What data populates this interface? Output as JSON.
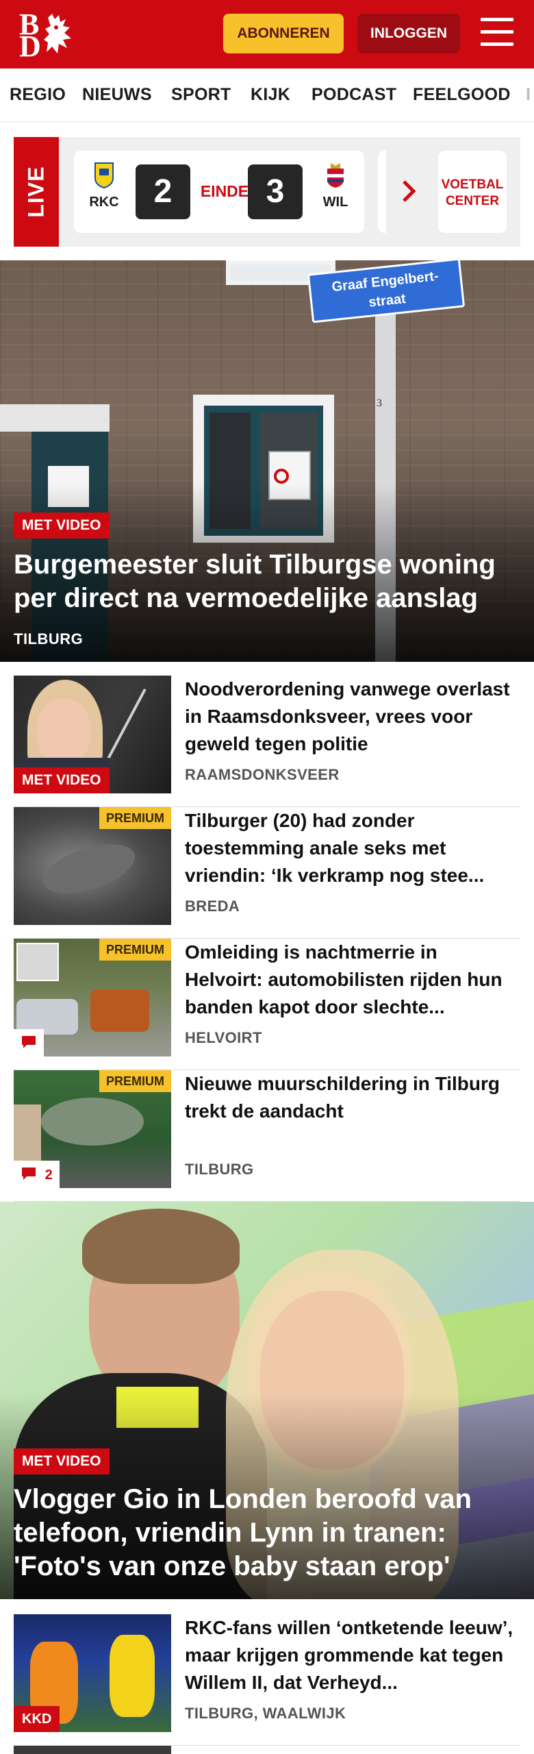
{
  "header": {
    "logo_top": "B",
    "logo_bottom": "D",
    "subscribe_label": "ABONNEREN",
    "login_label": "INLOGGEN",
    "brand_color": "#cd0a12"
  },
  "nav": {
    "items": [
      "REGIO",
      "NIEUWS",
      "SPORT",
      "KIJK",
      "PODCAST",
      "FEELGOOD"
    ]
  },
  "live": {
    "label": "LIVE",
    "match": {
      "home": "RKC",
      "home_score": "2",
      "status": "EINDE",
      "away_score": "3",
      "away": "WIL"
    },
    "center_label_line1": "VOETBAL",
    "center_label_line2": "CENTER"
  },
  "hero": {
    "badge": "MET VIDEO",
    "sign_line1": "Graaf Engelbert-",
    "sign_line2": "straat",
    "title": "Burgemeester sluit Tilburgse woning per direct na vermoedelijke aanslag",
    "location": "TILBURG"
  },
  "articles": [
    {
      "title": "Noodverordening vanwege overlast in Raamsdonksveer, vrees voor geweld tegen politie",
      "location": "RAAMSDONKSVEER",
      "badge": "MET VIDEO"
    },
    {
      "title": "Tilburger (20) had zonder toestemming anale seks met vriendin: ‘Ik verkramp nog stee...",
      "location": "BREDA",
      "premium": "PREMIUM"
    },
    {
      "title": "Omleiding is nachtmerrie in Helvoirt: automobilisten rijden hun banden kapot door slechte...",
      "location": "HELVOIRT",
      "premium": "PREMIUM",
      "comments": ""
    },
    {
      "title": "Nieuwe muurschildering in Tilburg trekt de aandacht",
      "location": "TILBURG",
      "premium": "PREMIUM",
      "comments": "2"
    }
  ],
  "hero2": {
    "badge": "MET VIDEO",
    "title": "Vlogger Gio in Londen beroofd van telefoon, vriendin Lynn in tranen: 'Foto's van onze baby staan erop'"
  },
  "articles2": [
    {
      "title": "RKC-fans willen ‘ontketende leeuw’, maar krijgen grommende kat tegen Willem II, dat Verheyd...",
      "location": "TILBURG, WAALWIJK",
      "badge": "KKD"
    }
  ]
}
